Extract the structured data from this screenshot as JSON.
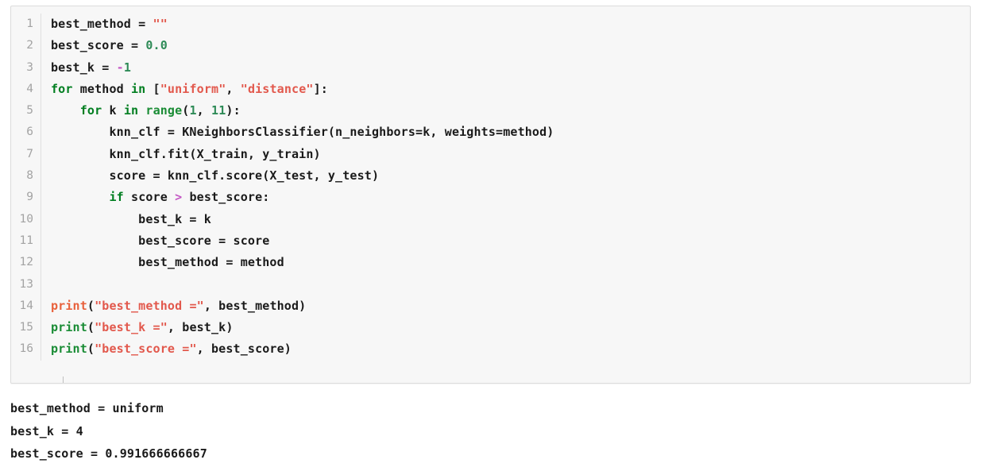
{
  "notebook": {
    "cell": {
      "kind": "code-cell",
      "language": "python",
      "background_color": "#f7f7f7",
      "border_color": "#dcdcdc",
      "gutter_color": "#a3a3a3",
      "line_numbers": [
        "1",
        "2",
        "3",
        "4",
        "5",
        "6",
        "7",
        "8",
        "9",
        "10",
        "11",
        "12",
        "13",
        "14",
        "15",
        "16"
      ],
      "lines": [
        {
          "number": "1",
          "text": "best_method = \"\"",
          "tokens": [
            {
              "t": "best_method ",
              "c": "p"
            },
            {
              "t": "= ",
              "c": "p"
            },
            {
              "t": "\"\"",
              "c": "s"
            }
          ]
        },
        {
          "number": "2",
          "text": "best_score = 0.0",
          "tokens": [
            {
              "t": "best_score = ",
              "c": "p"
            },
            {
              "t": "0.0",
              "c": "n"
            }
          ]
        },
        {
          "number": "3",
          "text": "best_k = -1",
          "tokens": [
            {
              "t": "best_k = ",
              "c": "p"
            },
            {
              "t": "-",
              "c": "o"
            },
            {
              "t": "1",
              "c": "n"
            }
          ]
        },
        {
          "number": "4",
          "text": "for method in [\"uniform\", \"distance\"]:",
          "tokens": [
            {
              "t": "for",
              "c": "k"
            },
            {
              "t": " method ",
              "c": "p"
            },
            {
              "t": "in",
              "c": "k"
            },
            {
              "t": " [",
              "c": "p"
            },
            {
              "t": "\"uniform\"",
              "c": "s"
            },
            {
              "t": ", ",
              "c": "p"
            },
            {
              "t": "\"distance\"",
              "c": "s"
            },
            {
              "t": "]:",
              "c": "p"
            }
          ]
        },
        {
          "number": "5",
          "text": "    for k in range(1, 11):",
          "tokens": [
            {
              "t": "    ",
              "c": "p"
            },
            {
              "t": "for",
              "c": "k"
            },
            {
              "t": " k ",
              "c": "p"
            },
            {
              "t": "in",
              "c": "k"
            },
            {
              "t": " ",
              "c": "p"
            },
            {
              "t": "range",
              "c": "bi"
            },
            {
              "t": "(",
              "c": "p"
            },
            {
              "t": "1",
              "c": "n"
            },
            {
              "t": ", ",
              "c": "p"
            },
            {
              "t": "11",
              "c": "n"
            },
            {
              "t": "):",
              "c": "p"
            }
          ]
        },
        {
          "number": "6",
          "text": "        knn_clf = KNeighborsClassifier(n_neighbors=k, weights=method)",
          "tokens": [
            {
              "t": "        knn_clf = KNeighborsClassifier(n_neighbors=k, weights=method)",
              "c": "p"
            }
          ]
        },
        {
          "number": "7",
          "text": "        knn_clf.fit(X_train, y_train)",
          "tokens": [
            {
              "t": "        knn_clf.fit(X_train, y_train)",
              "c": "p"
            }
          ]
        },
        {
          "number": "8",
          "text": "        score = knn_clf.score(X_test, y_test)",
          "tokens": [
            {
              "t": "        score = knn_clf.score(X_test, y_test)",
              "c": "p"
            }
          ]
        },
        {
          "number": "9",
          "text": "        if score > best_score:",
          "tokens": [
            {
              "t": "        ",
              "c": "p"
            },
            {
              "t": "if",
              "c": "k"
            },
            {
              "t": " score ",
              "c": "p"
            },
            {
              "t": ">",
              "c": "o"
            },
            {
              "t": " best_score:",
              "c": "p"
            }
          ]
        },
        {
          "number": "10",
          "text": "            best_k = k",
          "tokens": [
            {
              "t": "            best_k = k",
              "c": "p"
            }
          ]
        },
        {
          "number": "11",
          "text": "            best_score = score",
          "tokens": [
            {
              "t": "            best_score = score",
              "c": "p"
            }
          ]
        },
        {
          "number": "12",
          "text": "            best_method = method",
          "tokens": [
            {
              "t": "            best_method = method",
              "c": "p"
            }
          ]
        },
        {
          "number": "13",
          "text": "",
          "tokens": []
        },
        {
          "number": "14",
          "text": "print(\"best_method =\", best_method)",
          "tokens": [
            {
              "t": "print",
              "c": "bir"
            },
            {
              "t": "(",
              "c": "p"
            },
            {
              "t": "\"best_method =\"",
              "c": "s"
            },
            {
              "t": ", best_method)",
              "c": "p"
            }
          ]
        },
        {
          "number": "15",
          "text": "print(\"best_k =\", best_k)",
          "tokens": [
            {
              "t": "print",
              "c": "bi"
            },
            {
              "t": "(",
              "c": "p"
            },
            {
              "t": "\"best_k =\"",
              "c": "s"
            },
            {
              "t": ", best_k)",
              "c": "p"
            }
          ]
        },
        {
          "number": "16",
          "text": "print(\"best_score =\", best_score)",
          "tokens": [
            {
              "t": "print",
              "c": "bi"
            },
            {
              "t": "(",
              "c": "p"
            },
            {
              "t": "\"best_score =\"",
              "c": "s"
            },
            {
              "t": ", best_score)",
              "c": "p"
            }
          ]
        }
      ]
    },
    "output": {
      "lines": [
        "best_method = uniform",
        "best_k = 4",
        "best_score = 0.991666666667"
      ],
      "values": {
        "best_method": "uniform",
        "best_k": "4",
        "best_score": "0.991666666667"
      }
    }
  },
  "palette": {
    "keyword": "#007e20",
    "builtin": "#1a8c35",
    "builtin_red": "#e8613c",
    "string": "#e2584c",
    "number": "#2e8b57",
    "operator": "#c457c4",
    "plain": "#1a1a1a",
    "cell_bg": "#f7f7f7",
    "page_bg": "#ffffff"
  }
}
